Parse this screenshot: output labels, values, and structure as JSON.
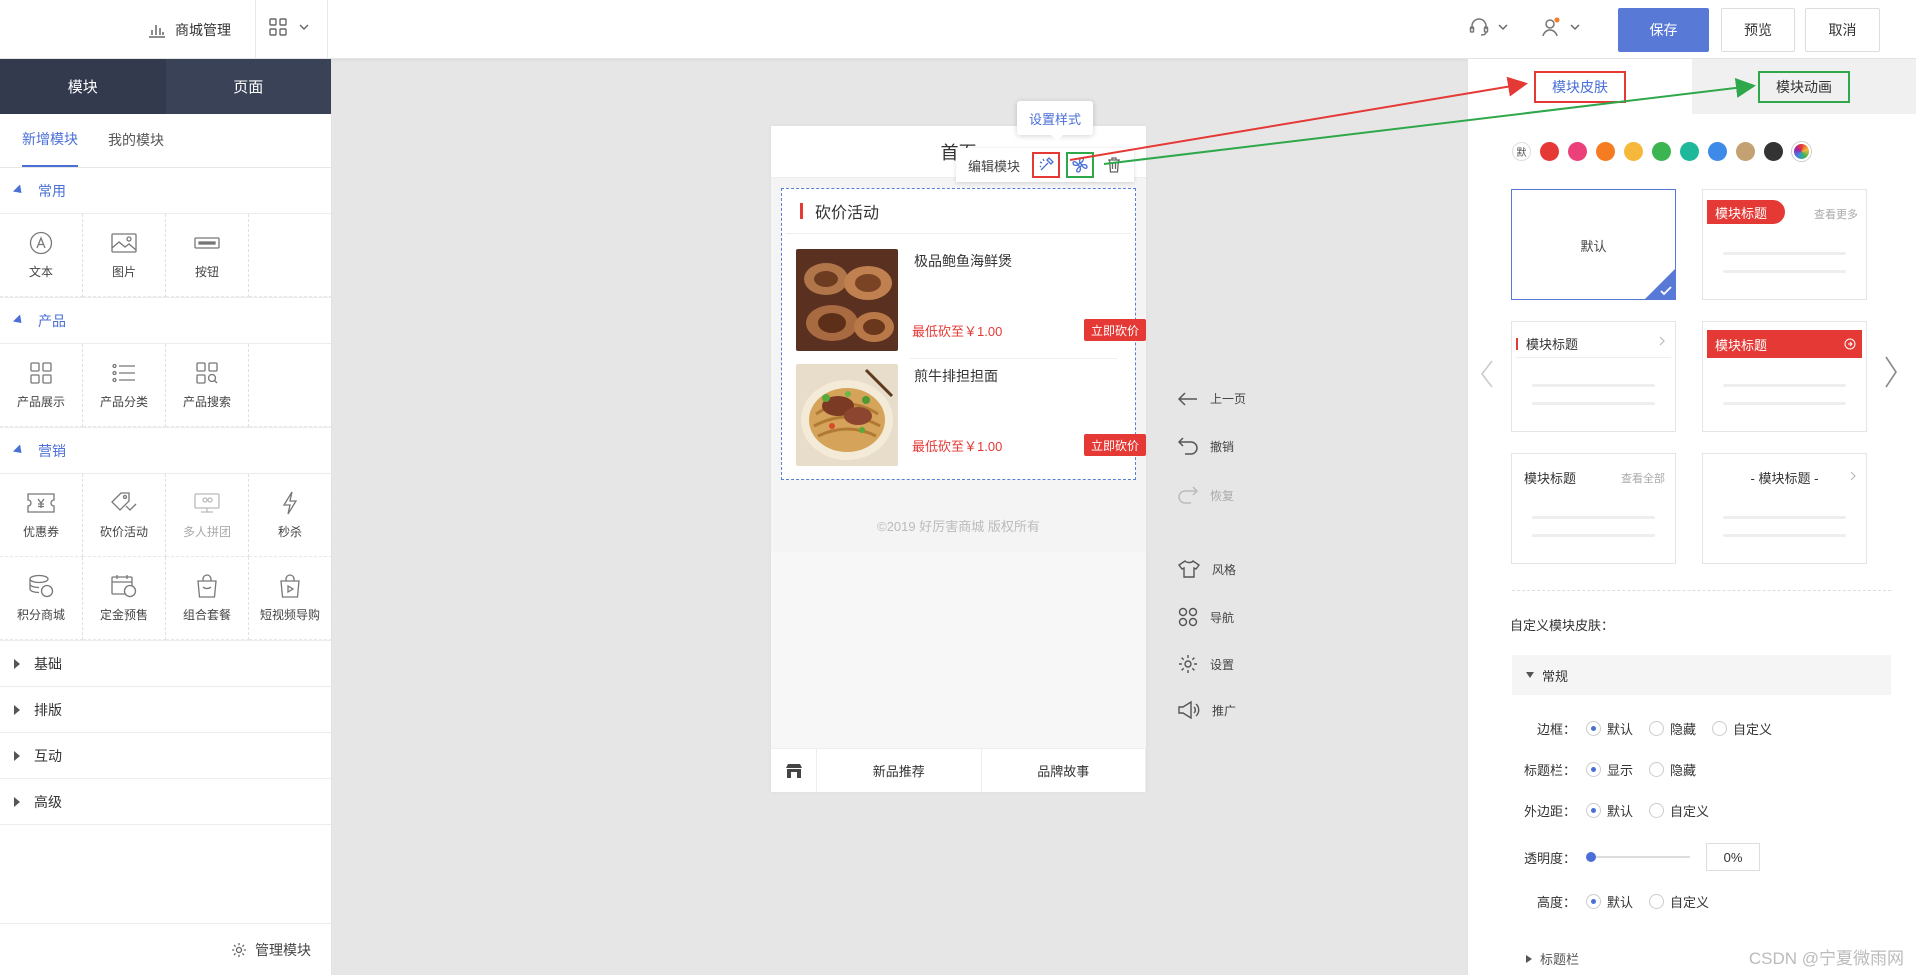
{
  "topbar": {
    "mall_label": "商城管理",
    "save": "保存",
    "preview": "预览",
    "cancel": "取消"
  },
  "left": {
    "tabs": [
      "模块",
      "页面"
    ],
    "subtabs": [
      "新增模块",
      "我的模块"
    ],
    "categories": {
      "common": "常用",
      "product": "产品",
      "marketing": "营销"
    },
    "common_items": [
      "文本",
      "图片",
      "按钮"
    ],
    "product_items": [
      "产品展示",
      "产品分类",
      "产品搜索"
    ],
    "marketing_items": [
      "优惠券",
      "砍价活动",
      "多人拼团",
      "秒杀",
      "积分商城",
      "定金预售",
      "组合套餐",
      "短视频导购"
    ],
    "collapsed": [
      "基础",
      "排版",
      "互动",
      "高级"
    ],
    "manage": "管理模块"
  },
  "phone": {
    "title": "首页",
    "module_title": "砍价活动",
    "products": [
      {
        "name": "极品鲍鱼海鲜煲",
        "price": "最低砍至￥1.00",
        "button": "立即砍价"
      },
      {
        "name": "煎牛排担担面",
        "price": "最低砍至￥1.00",
        "button": "立即砍价"
      }
    ],
    "copyright": "©2019 好厉害商城 版权所有",
    "nav": [
      "新品推荐",
      "品牌故事"
    ]
  },
  "floating": {
    "tooltip": "设置样式",
    "edit_module": "编辑模块"
  },
  "sidetools": [
    "上一页",
    "撤销",
    "恢复",
    "风格",
    "导航",
    "设置",
    "推广"
  ],
  "right": {
    "tabs": [
      "模块皮肤",
      "模块动画"
    ],
    "default_swatch": "默",
    "swatches": [
      "#e53935",
      "#ec407a",
      "#f57c20",
      "#f5b83a",
      "#3bb552",
      "#1fb89a",
      "#3d8ae8",
      "#c3a172",
      "#333333"
    ],
    "skins": {
      "default": "默认",
      "title": "模块标题",
      "more": "查看更多",
      "all": "查看全部",
      "dash_title": "- 模块标题 -"
    },
    "custom_label": "自定义模块皮肤：",
    "section": "常规",
    "border_label": "边框：",
    "border_opts": [
      "默认",
      "隐藏",
      "自定义"
    ],
    "titlebar_label": "标题栏：",
    "titlebar_opts": [
      "显示",
      "隐藏"
    ],
    "margin_label": "外边距：",
    "margin_opts": [
      "默认",
      "自定义"
    ],
    "opacity_label": "透明度：",
    "opacity_value": "0%",
    "height_label": "高度：",
    "height_opts": [
      "默认",
      "自定义"
    ],
    "next_section": "标题栏"
  },
  "watermark": "CSDN @宁夏微雨网"
}
